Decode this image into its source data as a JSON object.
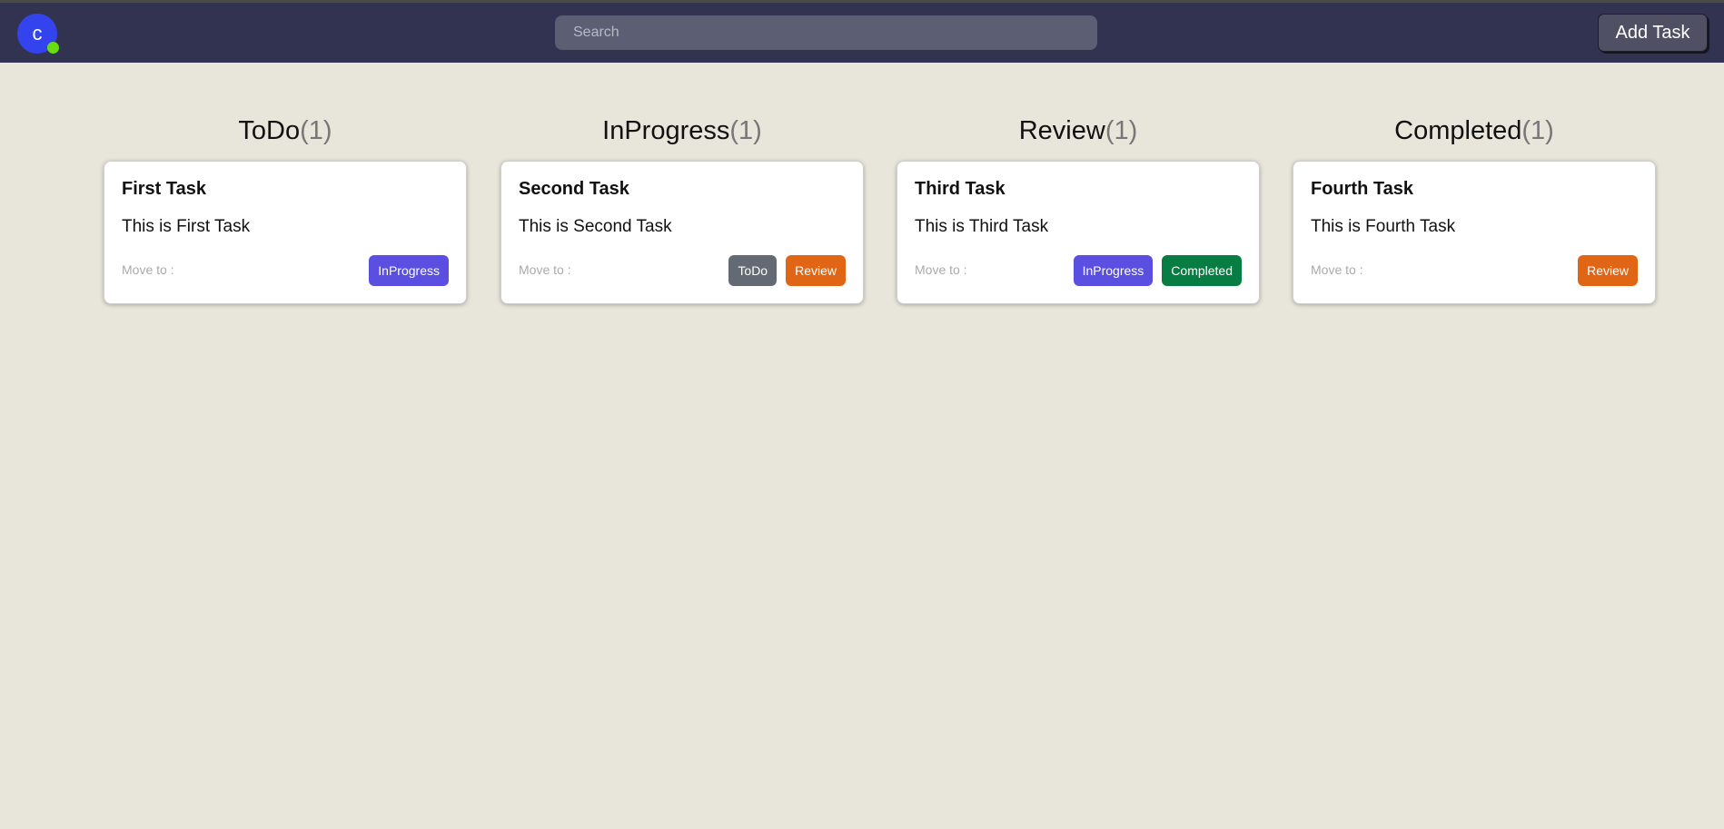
{
  "header": {
    "avatar_letter": "c",
    "search_placeholder": "Search",
    "add_task_label": "Add Task"
  },
  "colors": {
    "topbar": "#323350",
    "background": "#e8e5da",
    "inprogress": "#5a4fe0",
    "todo": "#646a74",
    "review": "#e06615",
    "completed": "#087d43",
    "online": "#66dd11"
  },
  "columns": [
    {
      "name": "ToDo",
      "count": "(1)",
      "cards": [
        {
          "title": "First Task",
          "description": "This is First Task",
          "move_label": "Move to :",
          "actions": [
            {
              "label": "InProgress",
              "color": "inprogress"
            }
          ]
        }
      ]
    },
    {
      "name": "InProgress",
      "count": "(1)",
      "cards": [
        {
          "title": "Second Task",
          "description": "This is Second Task",
          "move_label": "Move to :",
          "actions": [
            {
              "label": "ToDo",
              "color": "todo"
            },
            {
              "label": "Review",
              "color": "review"
            }
          ]
        }
      ]
    },
    {
      "name": "Review",
      "count": "(1)",
      "cards": [
        {
          "title": "Third Task",
          "description": "This is Third Task",
          "move_label": "Move to :",
          "actions": [
            {
              "label": "InProgress",
              "color": "inprogress"
            },
            {
              "label": "Completed",
              "color": "completed"
            }
          ]
        }
      ]
    },
    {
      "name": "Completed",
      "count": "(1)",
      "cards": [
        {
          "title": "Fourth Task",
          "description": "This is Fourth Task",
          "move_label": "Move to :",
          "actions": [
            {
              "label": "Review",
              "color": "review"
            }
          ]
        }
      ]
    }
  ]
}
